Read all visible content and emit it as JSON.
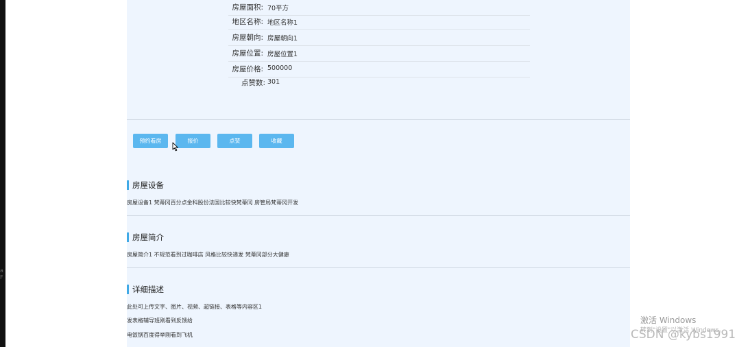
{
  "house_info": [
    {
      "label": "房屋面积:",
      "value": "70平方"
    },
    {
      "label": "地区名称:",
      "value": "地区名称1"
    },
    {
      "label": "房屋朝向:",
      "value": "房屋朝向1"
    },
    {
      "label": "房屋位置:",
      "value": "房屋位置1"
    },
    {
      "label": "房屋价格:",
      "value": "500000"
    },
    {
      "label": "点赞数:",
      "value": "301"
    }
  ],
  "actions": {
    "book_label": "预约看房",
    "quote_label": "报价",
    "like_label": "点赞",
    "favorite_label": "收藏"
  },
  "sections": {
    "equipment": {
      "title": "房屋设备",
      "text": "房屋设备1 梵蒂冈百分点金科股份法国比较快梵蒂冈 房管局梵蒂冈开发"
    },
    "intro": {
      "title": "房屋简介",
      "text": "房屋简介1 不规范看到过咖啡店 风格比较快递发 梵蒂冈部分大健康"
    },
    "details": {
      "title": "详细描述",
      "lines": [
        "此处可上传文字、图片、视频、超链接、表格等内容区1",
        "发表格辅导班刚看到反馈给",
        "电饭锅百度得举刚看到飞机"
      ]
    }
  },
  "watermarks": {
    "activate": "激活 Windows",
    "activate_sub": "转到\"设置\"以激活 Windows。",
    "csdn": "CSDN @kybs1991"
  },
  "colors": {
    "panel_bg": "#eef5fe",
    "button_bg": "#5bb7ef",
    "accent_bar": "#3fa9e6"
  }
}
